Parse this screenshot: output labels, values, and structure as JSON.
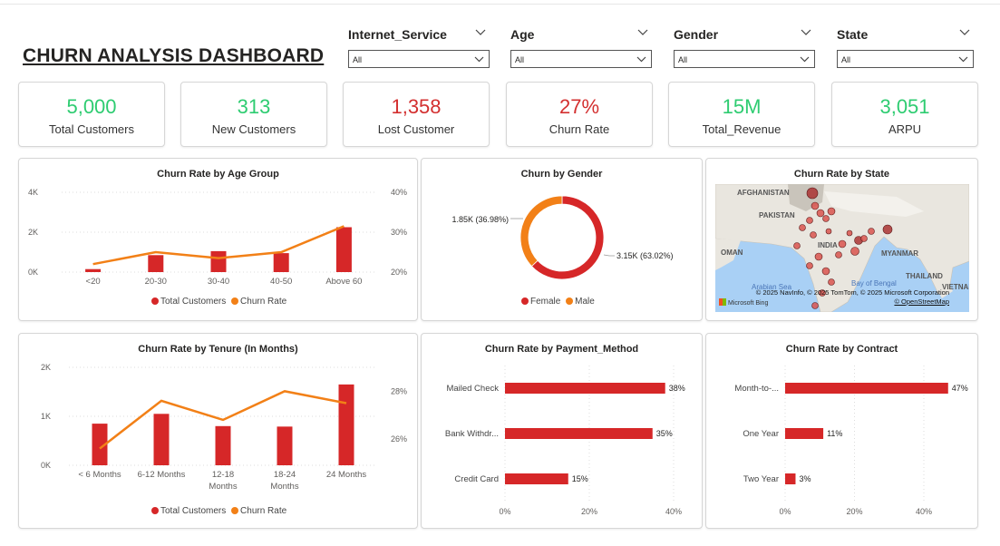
{
  "title": "CHURN ANALYSIS DASHBOARD",
  "slicers": [
    {
      "label": "Internet_Service",
      "value": "All"
    },
    {
      "label": "Age",
      "value": "All"
    },
    {
      "label": "Gender",
      "value": "All"
    },
    {
      "label": "State",
      "value": "All"
    }
  ],
  "kpis": [
    {
      "value": "5,000",
      "label": "Total Customers",
      "color": "#2ecc71"
    },
    {
      "value": "313",
      "label": "New Customers",
      "color": "#2ecc71"
    },
    {
      "value": "1,358",
      "label": "Lost Customer",
      "color": "#d32f2f"
    },
    {
      "value": "27%",
      "label": "Churn Rate",
      "color": "#d32f2f"
    },
    {
      "value": "15M",
      "label": "Total_Revenue",
      "color": "#2ecc71"
    },
    {
      "value": "3,051",
      "label": "ARPU",
      "color": "#2ecc71"
    }
  ],
  "colors": {
    "bar": "#d62728",
    "line": "#f28017",
    "male": "#f28017",
    "female": "#d62728"
  },
  "legend": {
    "total_customers": "Total Customers",
    "churn_rate": "Churn Rate",
    "female": "Female",
    "male": "Male"
  },
  "map": {
    "labels": [
      "AFGHANISTAN",
      "PAKISTAN",
      "INDIA",
      "OMAN",
      "MYANMAR",
      "THAILAND",
      "VIETNAM",
      "Bay of Bengal",
      "Arabian Sea"
    ],
    "attribution": "© 2025 NavInfo, © 2025 TomTom, © 2025 Microsoft Corporation",
    "attribution2": "© OpenStreetMap",
    "bing": "Microsoft Bing"
  },
  "chart_data": [
    {
      "type": "bar",
      "title": "Churn Rate by Age Group",
      "categories": [
        "<20",
        "20-30",
        "30-40",
        "40-50",
        "Above 60"
      ],
      "series": [
        {
          "name": "Total Customers",
          "axis": "left",
          "values": [
            150,
            850,
            1050,
            950,
            2250
          ]
        },
        {
          "name": "Churn Rate",
          "axis": "right",
          "type": "line",
          "values": [
            22,
            25,
            23.5,
            25,
            31.5
          ]
        }
      ],
      "y_left": {
        "ticks": [
          "0K",
          "2K",
          "4K"
        ],
        "range": [
          0,
          4000
        ]
      },
      "y_right": {
        "ticks": [
          "20%",
          "30%",
          "40%"
        ],
        "range": [
          20,
          40
        ]
      },
      "legend": "bottom-center"
    },
    {
      "type": "pie",
      "title": "Churn by Gender",
      "donut": true,
      "slices": [
        {
          "name": "Female",
          "value": 3150,
          "label": "3.15K (63.02%)"
        },
        {
          "name": "Male",
          "value": 1850,
          "label": "1.85K (36.98%)"
        }
      ],
      "legend": "bottom-center"
    },
    {
      "type": "scatter",
      "title": "Churn Rate by State",
      "note": "bubble map of India"
    },
    {
      "type": "bar",
      "title": "Churn Rate by Tenure (In Months)",
      "categories": [
        "< 6 Months",
        "6-12 Months",
        "12-18 Months",
        "18-24 Months",
        "24 Months"
      ],
      "category_lines": [
        [
          "< 6 Months"
        ],
        [
          "6-12 Months"
        ],
        [
          "12-18",
          "Months"
        ],
        [
          "18-24",
          "Months"
        ],
        [
          "24 Months"
        ]
      ],
      "series": [
        {
          "name": "Total Customers",
          "axis": "left",
          "values": [
            850,
            1050,
            800,
            790,
            1650
          ]
        },
        {
          "name": "Churn Rate",
          "axis": "right",
          "type": "line",
          "values": [
            25.6,
            27.6,
            26.8,
            28.0,
            27.5
          ]
        }
      ],
      "y_left": {
        "ticks": [
          "0K",
          "1K",
          "2K"
        ],
        "range": [
          0,
          2000
        ]
      },
      "y_right": {
        "ticks": [
          "26%",
          "28%"
        ],
        "range": [
          24.9,
          29.0
        ]
      },
      "legend": "bottom-center"
    },
    {
      "type": "bar",
      "orientation": "horizontal",
      "title": "Churn Rate by Payment_Method",
      "categories": [
        "Mailed Check",
        "Bank Withdr...",
        "Credit Card"
      ],
      "values": [
        38,
        35,
        15
      ],
      "data_labels": [
        "38%",
        "35%",
        "15%"
      ],
      "x_ticks": [
        "0%",
        "20%",
        "40%"
      ],
      "xlim": [
        0,
        40
      ]
    },
    {
      "type": "bar",
      "orientation": "horizontal",
      "title": "Churn Rate by Contract",
      "categories": [
        "Month-to-...",
        "One Year",
        "Two Year"
      ],
      "values": [
        47,
        11,
        3
      ],
      "data_labels": [
        "47%",
        "11%",
        "3%"
      ],
      "x_ticks": [
        "0%",
        "20%",
        "40%"
      ],
      "xlim": [
        0,
        40
      ]
    }
  ]
}
